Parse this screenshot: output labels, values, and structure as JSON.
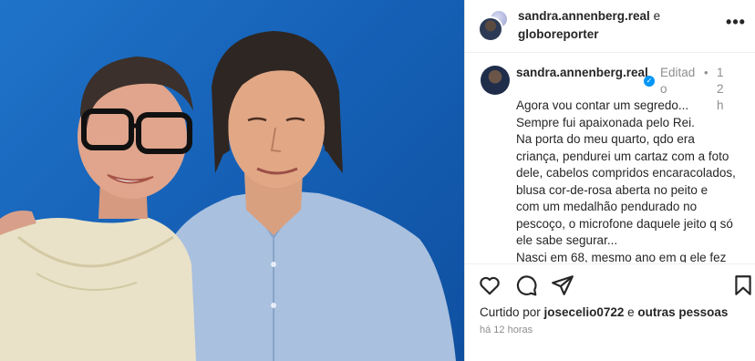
{
  "header": {
    "user1": "sandra.annenberg.real",
    "connector": " e",
    "user2": "globoreporter",
    "more_icon": "more-horizontal-icon"
  },
  "caption": {
    "username": "sandra.annenberg.real",
    "verified_icon": "verified-badge-icon",
    "edited": "Editado",
    "separator": "•",
    "time": "12h",
    "lines": [
      "Agora vou contar um segredo...",
      "Sempre fui apaixonada pelo Rei.",
      "Na porta do meu quarto, qdo era",
      "criança, pendurei um cartaz com a foto",
      "dele, cabelos compridos encaracolados,",
      "blusa cor-de-rosa aberta no peito e",
      "com um medalhão pendurado no",
      "pescoço, o microfone daquele jeito q só",
      "ele sabe segurar...",
      "Nasci em 68, mesmo ano em q ele fez"
    ]
  },
  "actions": {
    "like_icon": "heart-icon",
    "comment_icon": "comment-icon",
    "share_icon": "send-icon",
    "save_icon": "bookmark-icon",
    "liked_prefix": "Curtido por ",
    "liked_user": "josecelio0722",
    "liked_mid": " e ",
    "liked_others": "outras pessoas",
    "time_ago": "há 12 horas"
  },
  "colors": {
    "photo_background": "#1662b8",
    "verified": "#0095f6",
    "muted_text": "#8e8e8e"
  }
}
